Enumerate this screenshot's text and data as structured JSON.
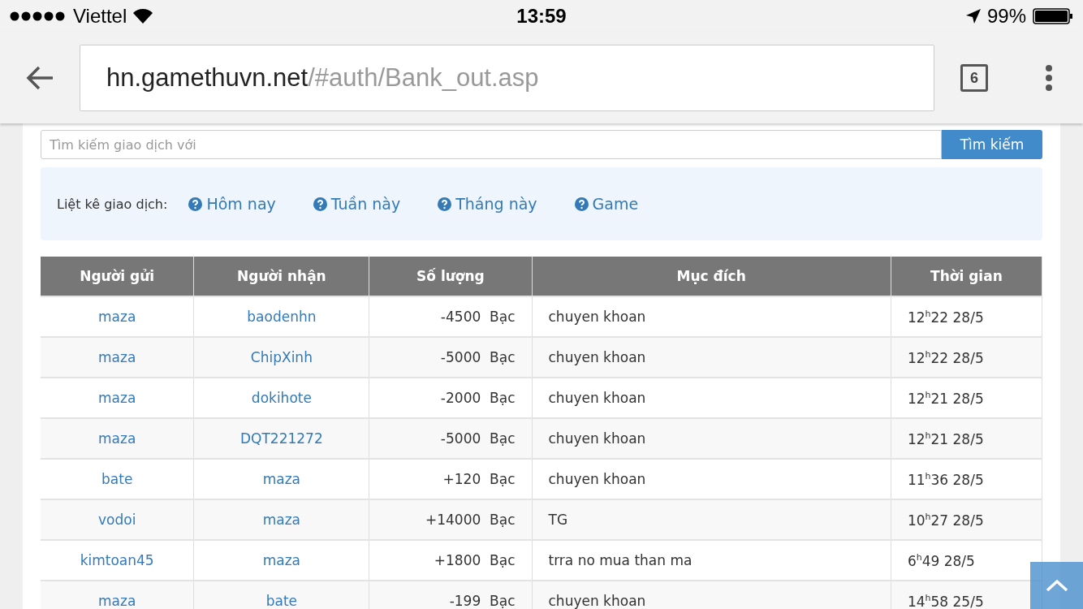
{
  "status_bar": {
    "carrier": "Viettel",
    "time": "13:59",
    "battery": "99%"
  },
  "browser": {
    "url_host": "hn.gamethuvn.net",
    "url_path": "/#auth/Bank_out.asp",
    "tab_count": "6"
  },
  "search": {
    "placeholder": "Tìm kiếm giao dịch với",
    "button": "Tìm kiếm"
  },
  "filter": {
    "label": "Liệt kê giao dịch:",
    "links": [
      "Hôm nay",
      "Tuần này",
      "Tháng này",
      "Game"
    ]
  },
  "table": {
    "columns": [
      "Người gửi",
      "Người nhận",
      "Số lượng",
      "Mục đích",
      "Thời gian"
    ],
    "rows": [
      {
        "sender": "maza",
        "receiver": "baodenhn",
        "amount": "-4500",
        "unit": "Bạc",
        "purpose": "chuyen khoan",
        "time": "12$^{h}$22 28/5"
      },
      {
        "sender": "maza",
        "receiver": "ChipXinh",
        "amount": "-5000",
        "unit": "Bạc",
        "purpose": "chuyen khoan",
        "time": "12$^{h}$22 28/5"
      },
      {
        "sender": "maza",
        "receiver": "dokihote",
        "amount": "-2000",
        "unit": "Bạc",
        "purpose": "chuyen khoan",
        "time": "12$^{h}$21 28/5"
      },
      {
        "sender": "maza",
        "receiver": "DQT221272",
        "amount": "-5000",
        "unit": "Bạc",
        "purpose": "chuyen khoan",
        "time": "12$^{h}$21 28/5"
      },
      {
        "sender": "bate",
        "receiver": "maza",
        "amount": "+120",
        "unit": "Bạc",
        "purpose": "chuyen khoan",
        "time": "11$^{h}$36 28/5"
      },
      {
        "sender": "vodoi",
        "receiver": "maza",
        "amount": "+14000",
        "unit": "Bạc",
        "purpose": "TG",
        "time": "10$^{h}$27 28/5"
      },
      {
        "sender": "kimtoan45",
        "receiver": "maza",
        "amount": "+1800",
        "unit": "Bạc",
        "purpose": "trra no mua than ma",
        "time": "6$^{h}$49 28/5"
      },
      {
        "sender": "maza",
        "receiver": "bate",
        "amount": "-199",
        "unit": "Bạc",
        "purpose": "chuyen khoan",
        "time": "14$^{h}$58 25/5"
      }
    ]
  }
}
